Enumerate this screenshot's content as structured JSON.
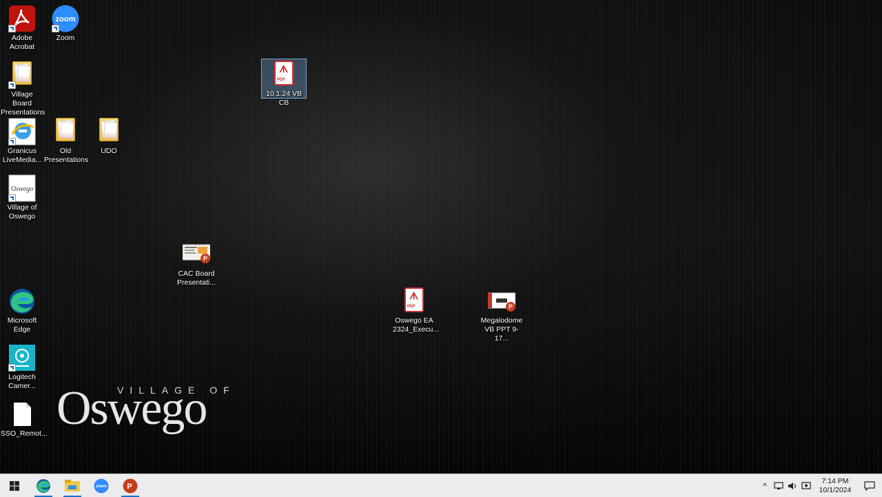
{
  "desktop": {
    "icons": [
      {
        "label": "Adobe Acrobat",
        "icon": "adobe-acrobat-icon",
        "shortcut": true
      },
      {
        "label": "Zoom",
        "icon": "zoom-icon",
        "shortcut": true
      },
      {
        "label": "Village Board Presentations",
        "icon": "folder-icon",
        "shortcut": true
      },
      {
        "label": "Granicus LiveMedia...",
        "icon": "granicus-icon",
        "shortcut": true
      },
      {
        "label": "Old Presentations",
        "icon": "folder-icon",
        "shortcut": false
      },
      {
        "label": "UDO",
        "icon": "folder-icon",
        "shortcut": false
      },
      {
        "label": "Village of Oswego",
        "icon": "oswego-site-icon",
        "shortcut": true
      },
      {
        "label": "CAC Board Presentati...",
        "icon": "powerpoint-file-icon",
        "shortcut": false
      },
      {
        "label": "Microsoft Edge",
        "icon": "edge-icon",
        "shortcut": false
      },
      {
        "label": "Logitech Camer...",
        "icon": "logitech-camera-icon",
        "shortcut": true
      },
      {
        "label": "SSO_Remot...",
        "icon": "blank-file-icon",
        "shortcut": false
      },
      {
        "label": "10.1.24 VB CB",
        "icon": "pdf-file-icon",
        "shortcut": false,
        "selected": true
      },
      {
        "label": "Oswego EA 2324_Execu...",
        "icon": "pdf-file-icon",
        "shortcut": false
      },
      {
        "label": "Megalodome VB PPT 9-17...",
        "icon": "powerpoint-file-icon",
        "shortcut": false
      }
    ],
    "wallpaper_logo": {
      "top": "VILLAGE OF",
      "main": "Oswego"
    }
  },
  "taskbar": {
    "apps": [
      {
        "name": "Start",
        "icon": "windows-start-icon"
      },
      {
        "name": "Microsoft Edge",
        "icon": "edge-icon"
      },
      {
        "name": "File Explorer",
        "icon": "file-explorer-icon"
      },
      {
        "name": "Zoom",
        "icon": "zoom-icon"
      },
      {
        "name": "PowerPoint",
        "icon": "powerpoint-icon"
      }
    ],
    "clock": {
      "time": "7:14 PM",
      "date": "10/1/2024"
    }
  },
  "colors": {
    "accent": "#1a73c8",
    "pdf_red": "#d32f2f",
    "zoom_blue": "#2d8cff"
  }
}
